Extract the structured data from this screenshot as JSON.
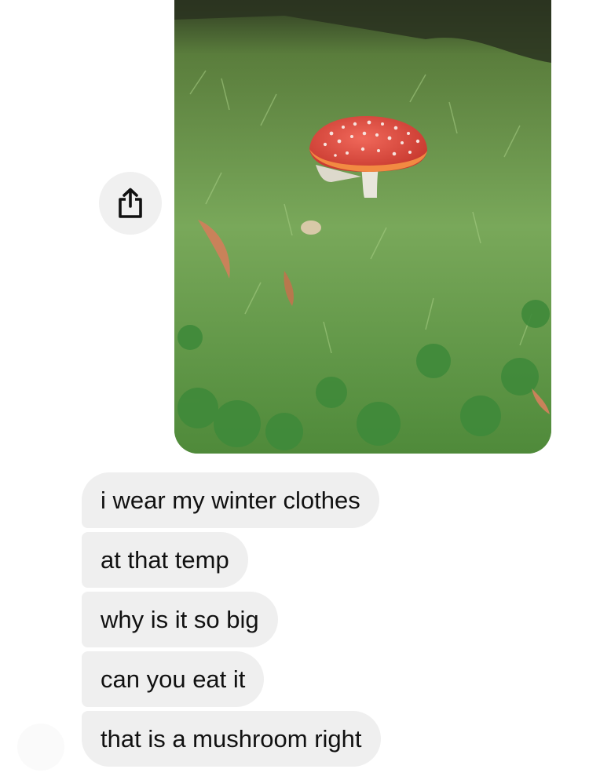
{
  "conversation": {
    "share_icon": "share-icon",
    "photo": {
      "subject": "mushroom-in-grass-photo"
    },
    "messages": [
      {
        "text": "i wear my winter clothes"
      },
      {
        "text": "at that temp"
      },
      {
        "text": "why is it so big"
      },
      {
        "text": "can you eat it"
      },
      {
        "text": "that is a mushroom right"
      }
    ]
  },
  "colors": {
    "bubble_bg": "#efefef",
    "share_bg": "#f0f0f0",
    "mushroom_cap": "#e0483f",
    "grass": "#5f8f3f"
  }
}
